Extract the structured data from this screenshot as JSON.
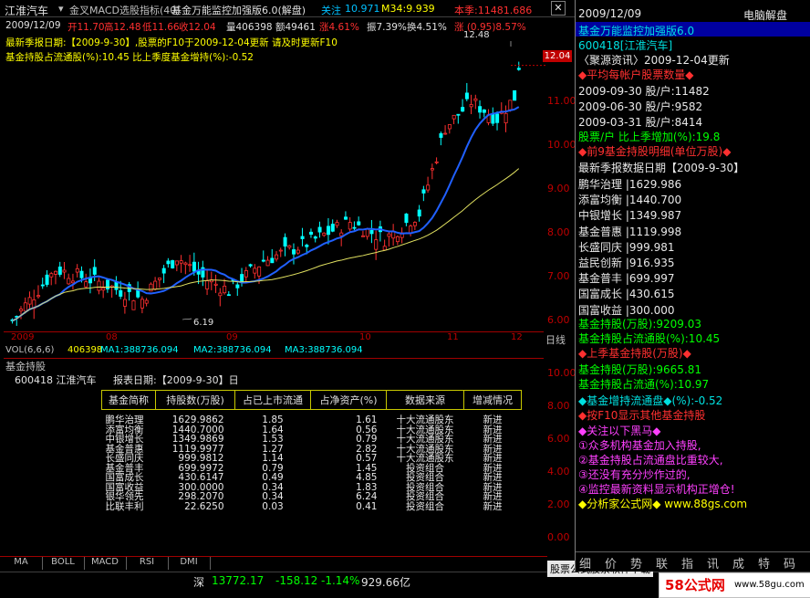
{
  "title_bar": {
    "stock_name": "江淮汽车",
    "indicator": "金叉MACD选股指标(40)",
    "formula": "基金万能监控加强版6.0(解盘)",
    "follow": "关注",
    "follow_val": "10.971",
    "m34": "M34:9.939",
    "benchmark": "本季:11481.686",
    "close": "✕"
  },
  "quote_line": {
    "date": "2009/12/09",
    "open": "开11.70",
    "high": "高12.48",
    "low": "低11.66",
    "close": "收12.04",
    "volume": "量406398",
    "amount": "额49461",
    "change": "涨4.61%",
    "amplitude": "振7.39%",
    "turnover": "换4.51%",
    "extra": "涨 (0.95)8.57%"
  },
  "chart_notes": {
    "line1": "最新季报日期:【2009-9-30】,股票的F10于2009-12-04更新 请及时更新F10",
    "line2": "基金持股占流通股(%):10.45  比上季度基金增持(%):-0.52",
    "high_label": "12.48",
    "low_label": "6.19",
    "current_price": "12.04"
  },
  "price_axis": [
    "11.00",
    "10.00",
    "9.00",
    "8.00",
    "7.00",
    "6.00"
  ],
  "x_axis": [
    "2009",
    "08",
    "09",
    "10",
    "11",
    "12"
  ],
  "x_axis_right": "日线",
  "vol_header": {
    "vol": "VOL(6,6,6)",
    "vol_val": "406398",
    "ma1": "MA1:388736.094",
    "ma2": "MA2:388736.094",
    "ma3": "MA3:388736.094"
  },
  "lower_panel": {
    "title": "基金持股",
    "code_name": "600418  江淮汽车",
    "report_date": "报表日期:【2009-9-30】日",
    "axis": [
      "10.00",
      "8.00",
      "6.00",
      "4.00",
      "2.00",
      "0.00"
    ],
    "columns": [
      "基金简称",
      "持股数(万股)",
      "占已上市流通",
      "占净资产(%)",
      "数据来源",
      "增减情况"
    ],
    "rows": [
      [
        "鹏华治理",
        "1629.9862",
        "1.85",
        "1.61",
        "十大流通股东",
        "新进"
      ],
      [
        "添富均衡",
        "1440.7000",
        "1.64",
        "0.56",
        "十大流通股东",
        "新进"
      ],
      [
        "中银增长",
        "1349.9869",
        "1.53",
        "0.79",
        "十大流通股东",
        "新进"
      ],
      [
        "基金普惠",
        "1119.9977",
        "1.27",
        "2.82",
        "十大流通股东",
        "新进"
      ],
      [
        "长盛同庆",
        "999.9812",
        "1.14",
        "0.57",
        "十大流通股东",
        "新进"
      ],
      [
        "基金普丰",
        "699.9972",
        "0.79",
        "1.45",
        "投资组合",
        "新进"
      ],
      [
        "国富成长",
        "430.6147",
        "0.49",
        "4.85",
        "投资组合",
        "新进"
      ],
      [
        "国富收益",
        "300.0000",
        "0.34",
        "1.83",
        "投资组合",
        "新进"
      ],
      [
        "银华领先",
        "298.2070",
        "0.34",
        "6.24",
        "投资组合",
        "新进"
      ],
      [
        "比联丰利",
        "22.6250",
        "0.03",
        "0.41",
        "投资组合",
        "新进"
      ]
    ]
  },
  "tabs": [
    "MA",
    "BOLL",
    "MACD",
    "RSI",
    "DMI"
  ],
  "status": {
    "index_name": "深",
    "index_val": "13772.17",
    "index_chg": "-158.12",
    "index_pct": "-1.14%",
    "index_amt": "929.66亿",
    "ad_text": "股票公式股票软件下载",
    "logo": "58公式网",
    "site": "www.58gu.com"
  },
  "right_panel": {
    "date": "2009/12/09",
    "header_right": "电脑解盘",
    "formula": "基金万能监控加强版6.0",
    "code": "600418[江淮汽车]",
    "news": "〈聚源资讯〉2009-12-04更新",
    "avg_title": "◆平均每帐户股票数量◆",
    "avg_rows": [
      "2009-09-30  股/户:11482",
      "2009-06-30  股/户:9582",
      "2009-03-31  股/户:8414"
    ],
    "avg_change": "股票/户 比上季增加(%):19.8",
    "top9_title": "◆前9基金持股明细(单位万股)◆",
    "report": "最新季报数据日期【2009-9-30】",
    "funds": [
      "鹏华治理 |1629.986",
      "添富均衡 |1440.700",
      "中银增长 |1349.987",
      "基金普惠 |1119.998",
      "长盛同庆 |999.981",
      "益民创新 |916.935",
      "基金普丰 |699.997",
      "国富成长 |430.615",
      "国富收益 |300.000"
    ],
    "hold_total": "基金持股(万股):9209.03",
    "hold_pct": "基金持股占流通股(%):10.45",
    "last_title": "◆上季基金持股(万股)◆",
    "last_hold": "基金持股(万股):9665.81",
    "last_pct": "基金持股占流通(%):10.97",
    "increase": "◆基金增持流通盘◆(%):-0.52",
    "f10": "◆按F10显示其他基金持股",
    "dark_title": "◆关注以下黑马◆",
    "dark_items": [
      "①众多机构基金加入持股,",
      "②基金持股占流通盘比重较大,",
      "③还没有充分炒作过的,",
      "④监控最新资料显示机构正增仓!"
    ],
    "footer": "◆分析家公式网◆ www.88gs.com",
    "bottom_tabs": [
      "细",
      "价",
      "势",
      "联",
      "指",
      "讯",
      "成",
      "特",
      "码"
    ]
  },
  "chart_data": {
    "type": "candlestick",
    "x": [
      "2009-06",
      "2009-07",
      "2009-08",
      "2009-09",
      "2009-10",
      "2009-11",
      "2009-12"
    ],
    "price_range": [
      6.0,
      12.5
    ],
    "high": 12.48,
    "low": 6.19,
    "last_close": 12.04,
    "ma_short": [
      6.0,
      6.9,
      7.1,
      7.2,
      7.6,
      8.3,
      10.4,
      10.9,
      11.1
    ],
    "ma_long": [
      6.0,
      6.4,
      6.9,
      7.2,
      7.5,
      8.1,
      9.1,
      9.9
    ]
  }
}
